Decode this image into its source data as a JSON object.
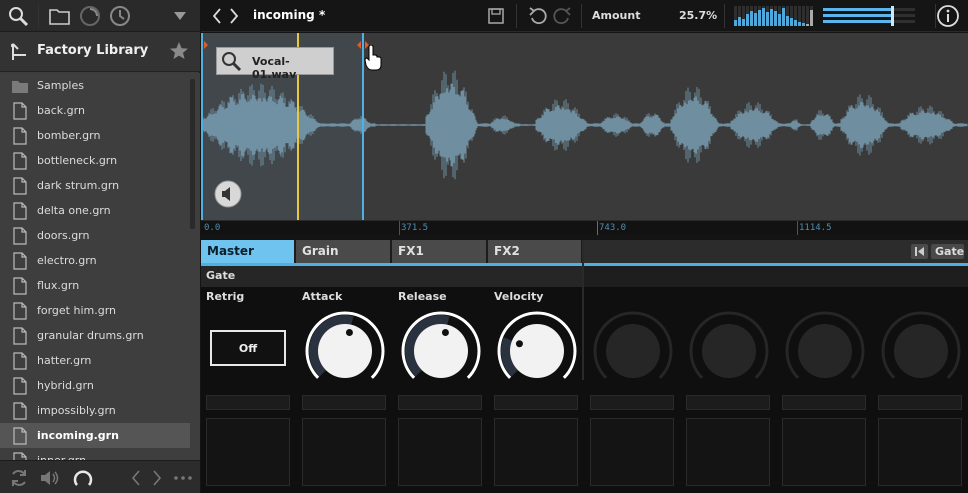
{
  "sidebar": {
    "library_title": "Factory Library",
    "items": [
      {
        "label": "Samples",
        "type": "folder"
      },
      {
        "label": "back.grn",
        "type": "file"
      },
      {
        "label": "bomber.grn",
        "type": "file"
      },
      {
        "label": "bottleneck.grn",
        "type": "file"
      },
      {
        "label": "dark strum.grn",
        "type": "file"
      },
      {
        "label": "delta one.grn",
        "type": "file"
      },
      {
        "label": "doors.grn",
        "type": "file"
      },
      {
        "label": "electro.grn",
        "type": "file"
      },
      {
        "label": "flux.grn",
        "type": "file"
      },
      {
        "label": "forget him.grn",
        "type": "file"
      },
      {
        "label": "granular drums.grn",
        "type": "file"
      },
      {
        "label": "hatter.grn",
        "type": "file"
      },
      {
        "label": "hybrid.grn",
        "type": "file"
      },
      {
        "label": "impossibly.grn",
        "type": "file"
      },
      {
        "label": "incoming.grn",
        "type": "file",
        "selected": true
      },
      {
        "label": "inner.grn",
        "type": "file"
      }
    ]
  },
  "topbar": {
    "title": "incoming *",
    "amount_label": "Amount",
    "amount_value": "25.7%"
  },
  "waveform": {
    "sample_name": "Vocal-01.wav",
    "ruler": [
      "0.0",
      "371.5",
      "743.0",
      "1114.5"
    ]
  },
  "tabs": [
    {
      "label": "Master",
      "active": true
    },
    {
      "label": "Grain"
    },
    {
      "label": "FX1"
    },
    {
      "label": "FX2"
    }
  ],
  "right_button": "Gate",
  "section": {
    "header": "Gate",
    "params": [
      "Retrig",
      "Attack",
      "Release",
      "Velocity"
    ],
    "retrig_value": "Off"
  },
  "knob_levels": {
    "attack": 0.55,
    "release": 0.55,
    "velocity": 0.25
  },
  "colors": {
    "accent": "#4fb0e6",
    "playhead": "#e8c840",
    "wave": "#6f8ea0"
  }
}
